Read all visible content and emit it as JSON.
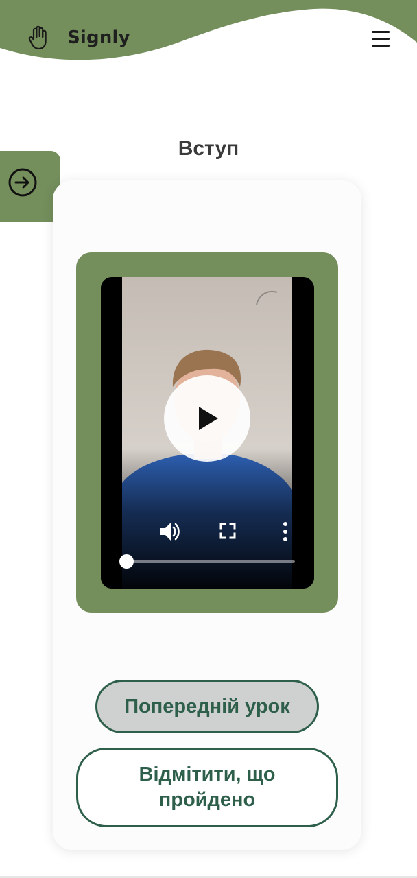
{
  "header": {
    "brand": "Signly",
    "logo_icon": "raised-hand-icon",
    "menu_icon": "hamburger-menu-icon"
  },
  "side_tab": {
    "icon": "arrow-right-circle-icon"
  },
  "lesson": {
    "title": "Вступ"
  },
  "video": {
    "play_icon": "play-icon",
    "volume_icon": "volume-icon",
    "fullscreen_icon": "fullscreen-icon",
    "more_icon": "more-vertical-icon",
    "progress_fraction": 0.01
  },
  "actions": {
    "previous_label": "Попередній урок",
    "mark_done_label": "Відмітити, що пройдено"
  },
  "colors": {
    "brand_green": "#748e5c",
    "button_dark_green": "#2e5f4b",
    "previous_button_bg": "#cfd0d0",
    "card_bg": "#fcfcfc"
  }
}
